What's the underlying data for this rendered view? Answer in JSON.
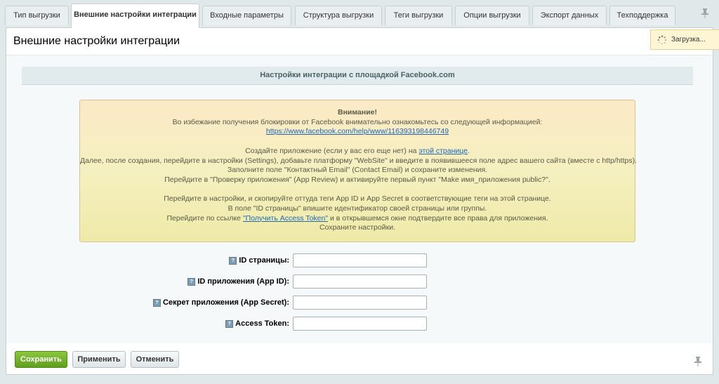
{
  "tabs": [
    {
      "label": "Тип выгрузки",
      "active": false
    },
    {
      "label": "Внешние настройки интеграции",
      "active": true
    },
    {
      "label": "Входные параметры",
      "active": false
    },
    {
      "label": "Структура выгрузки",
      "active": false
    },
    {
      "label": "Теги выгрузки",
      "active": false
    },
    {
      "label": "Опции выгрузки",
      "active": false
    },
    {
      "label": "Экспорт данных",
      "active": false
    },
    {
      "label": "Техподдержка",
      "active": false
    }
  ],
  "page_title": "Внешние настройки интеграции",
  "loading_text": "Загрузка...",
  "section_header": "Настройки интеграции с площадкой Facebook.com",
  "notice": {
    "title": "Внимание!",
    "line1": "Во избежание получения блокировки от Facebook внимательно ознакомьтесь со следующей информацией:",
    "link1": "https://www.facebook.com/help/www/116393198446749",
    "p2_before": "Создайте приложение (если у вас его еще нет) на ",
    "p2_link": "этой странице",
    "p2_after": ".",
    "line3": "Далее, после создания, перейдите в настройки (Settings), добавьте платформу \"WebSite\" и введите в появившееся поле адрес вашего сайта (вместе с http/https).",
    "line4": "Заполните поле \"Контактный Email\" (Contact Email) и сохраните изменения.",
    "line5": "Перейдите в \"Проверку приложения\" (App Review) и активируйте первый пункт \"Make имя_приложения public?\".",
    "line6": "Перейдите в настройки, и скопируйте оттуда теги App ID и App Secret в соответствующие теги на этой странице.",
    "line7": "В поле \"ID страницы\" впишите идентификатор своей страницы или группы.",
    "p8_before": "Перейдите по ссылке ",
    "p8_link": "\"Получить Access Token\"",
    "p8_after": " и в открывшемся окне подтвердите все права для приложения.",
    "line9": "Сохраните настройки."
  },
  "form": {
    "page_id": {
      "label": "ID страницы:",
      "value": ""
    },
    "app_id": {
      "label": "ID приложения (App ID):",
      "value": ""
    },
    "app_secret": {
      "label": "Секрет приложения (App Secret):",
      "value": ""
    },
    "access_token": {
      "label": "Access Token:",
      "value": ""
    }
  },
  "help_icon_glyph": "?",
  "buttons": {
    "save": "Сохранить",
    "apply": "Применить",
    "cancel": "Отменить"
  },
  "colors": {
    "save_button": "#6aaa25",
    "link": "#2067b0",
    "notice_bg": "#f5f0c0"
  }
}
